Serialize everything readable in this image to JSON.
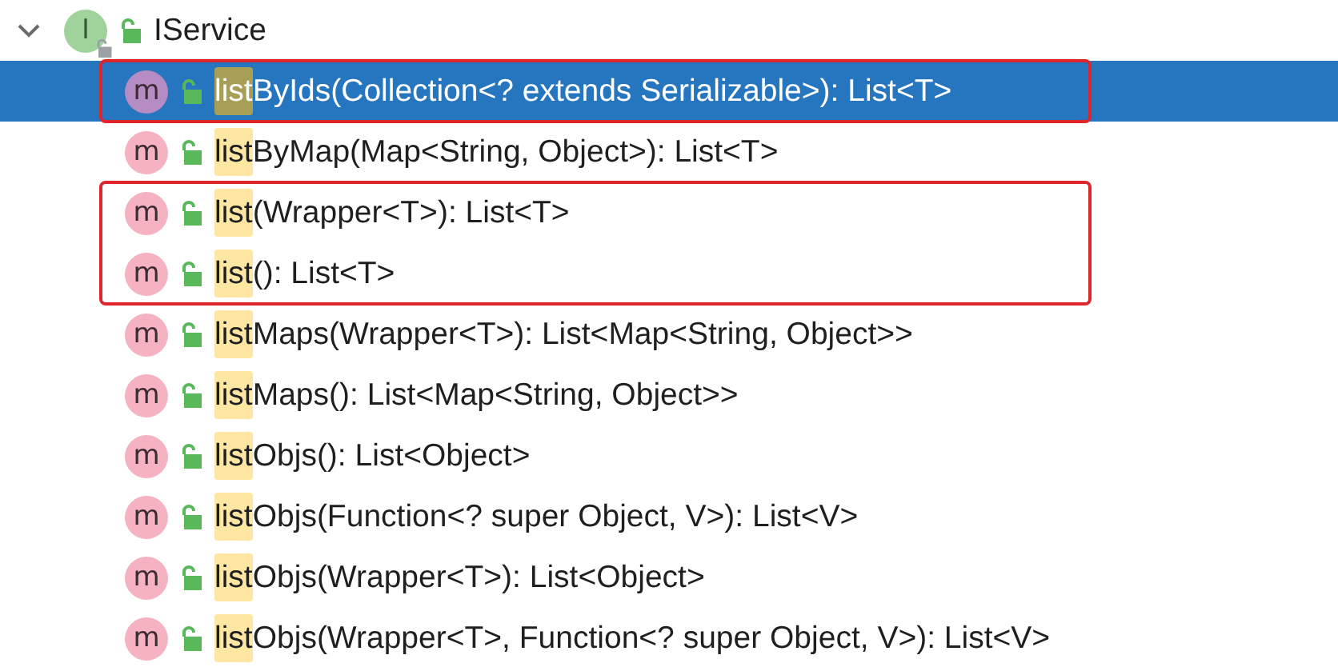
{
  "tree": {
    "label": "IService",
    "icon_letter": "I",
    "expanded": true,
    "groups": [
      {
        "outlined": true,
        "items": [
          {
            "icon_letter": "m",
            "match": "list",
            "rest": "ByIds(Collection<? extends Serializable>): List<T>",
            "selected": true
          }
        ]
      },
      {
        "outlined": false,
        "items": [
          {
            "icon_letter": "m",
            "match": "list",
            "rest": "ByMap(Map<String, Object>): List<T>",
            "selected": false
          }
        ]
      },
      {
        "outlined": true,
        "items": [
          {
            "icon_letter": "m",
            "match": "list",
            "rest": "(Wrapper<T>): List<T>",
            "selected": false
          },
          {
            "icon_letter": "m",
            "match": "list",
            "rest": "(): List<T>",
            "selected": false
          }
        ]
      },
      {
        "outlined": false,
        "items": [
          {
            "icon_letter": "m",
            "match": "list",
            "rest": "Maps(Wrapper<T>): List<Map<String, Object>>",
            "selected": false
          },
          {
            "icon_letter": "m",
            "match": "list",
            "rest": "Maps(): List<Map<String, Object>>",
            "selected": false
          },
          {
            "icon_letter": "m",
            "match": "list",
            "rest": "Objs(): List<Object>",
            "selected": false
          },
          {
            "icon_letter": "m",
            "match": "list",
            "rest": "Objs(Function<? super Object, V>): List<V>",
            "selected": false
          },
          {
            "icon_letter": "m",
            "match": "list",
            "rest": "Objs(Wrapper<T>): List<Object>",
            "selected": false
          },
          {
            "icon_letter": "m",
            "match": "list",
            "rest": "Objs(Wrapper<T>, Function<? super Object, V>): List<V>",
            "selected": false
          }
        ]
      }
    ]
  }
}
